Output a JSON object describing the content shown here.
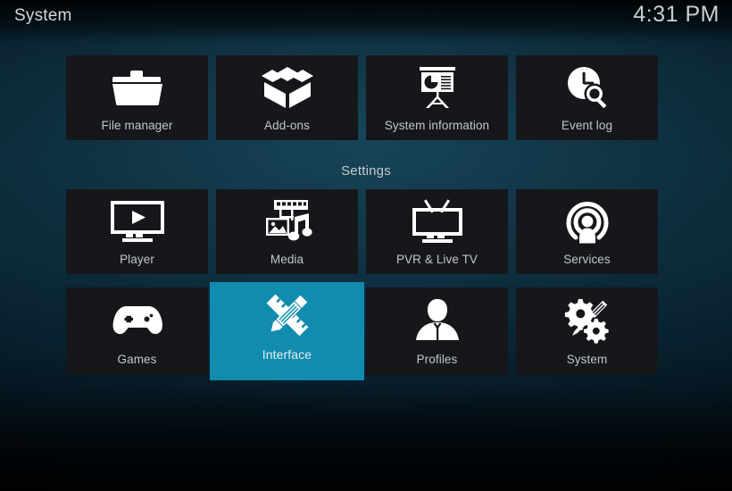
{
  "header": {
    "title": "System",
    "clock": "4:31 PM"
  },
  "section": {
    "settings_heading": "Settings"
  },
  "colors": {
    "selected_tile": "#118cae",
    "tile_background": "#15171b",
    "label_text": "#c3c7c9",
    "icon": "#ffffff"
  },
  "rows": {
    "top": [
      {
        "label": "File manager",
        "icon": "folder-icon",
        "selected": false
      },
      {
        "label": "Add-ons",
        "icon": "open-box-icon",
        "selected": false
      },
      {
        "label": "System information",
        "icon": "presentation-chart-icon",
        "selected": false
      },
      {
        "label": "Event log",
        "icon": "clock-magnifier-icon",
        "selected": false
      }
    ],
    "middle": [
      {
        "label": "Player",
        "icon": "monitor-play-icon",
        "selected": false
      },
      {
        "label": "Media",
        "icon": "film-photo-music-icon",
        "selected": false
      },
      {
        "label": "PVR & Live TV",
        "icon": "tv-antenna-icon",
        "selected": false
      },
      {
        "label": "Services",
        "icon": "broadcast-person-icon",
        "selected": false
      }
    ],
    "bottom": [
      {
        "label": "Games",
        "icon": "gamepad-icon",
        "selected": false
      },
      {
        "label": "Interface",
        "icon": "pencil-ruler-icon",
        "selected": true
      },
      {
        "label": "Profiles",
        "icon": "person-bust-icon",
        "selected": false
      },
      {
        "label": "System",
        "icon": "gears-screwdriver-icon",
        "selected": false
      }
    ]
  }
}
